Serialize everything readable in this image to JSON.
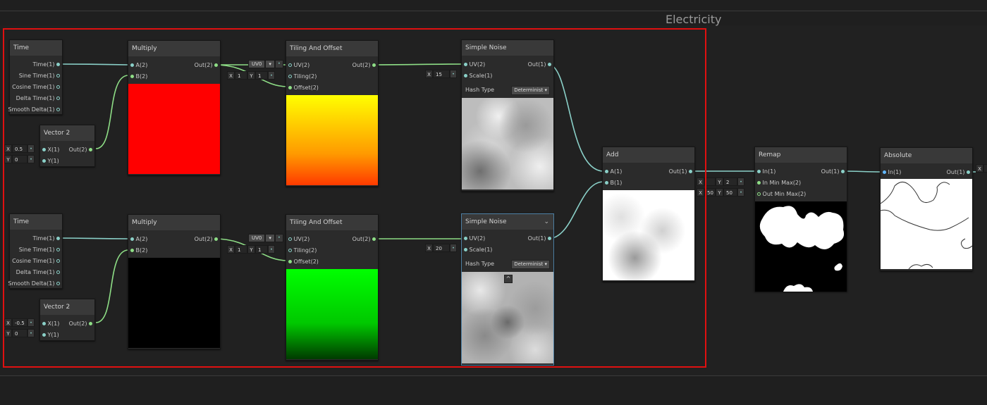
{
  "group": {
    "title": "Electricity"
  },
  "time_node": {
    "title": "Time",
    "outputs": [
      "Time(1)",
      "Sine Time(1)",
      "Cosine Time(1)",
      "Delta Time(1)",
      "Smooth Delta(1)"
    ]
  },
  "vector2_top": {
    "title": "Vector 2",
    "x_label": "X",
    "x_value": "0.5",
    "y_label": "Y",
    "y_value": "0",
    "in_x": "X(1)",
    "in_y": "Y(1)",
    "out": "Out(2)"
  },
  "vector2_bottom": {
    "title": "Vector 2",
    "x_label": "X",
    "x_value": "-0.5",
    "y_label": "Y",
    "y_value": "0",
    "in_x": "X(1)",
    "in_y": "Y(1)",
    "out": "Out(2)"
  },
  "multiply": {
    "title": "Multiply",
    "in_a": "A(2)",
    "in_b": "B(2)",
    "out": "Out(2)"
  },
  "tiling_top": {
    "title": "Tiling And Offset",
    "in_uv": "UV(2)",
    "in_tiling": "Tiling(2)",
    "in_offset": "Offset(2)",
    "out": "Out(2)",
    "uv_option": "UV0",
    "tx_label": "X",
    "tx_value": "1",
    "ty_label": "Y",
    "ty_value": "1"
  },
  "tiling_bottom": {
    "title": "Tiling And Offset",
    "in_uv": "UV(2)",
    "in_tiling": "Tiling(2)",
    "in_offset": "Offset(2)",
    "out": "Out(2)",
    "uv_option": "UV0",
    "tx_label": "X",
    "tx_value": "1",
    "ty_label": "Y",
    "ty_value": "1"
  },
  "noise_top": {
    "title": "Simple Noise",
    "in_uv": "UV(2)",
    "in_scale": "Scale(1)",
    "out": "Out(1)",
    "hash_label": "Hash Type",
    "hash_value": "Determinist",
    "scale_label": "X",
    "scale_value": "15"
  },
  "noise_bottom": {
    "title": "Simple Noise",
    "in_uv": "UV(2)",
    "in_scale": "Scale(1)",
    "out": "Out(1)",
    "hash_label": "Hash Type",
    "hash_value": "Determinist",
    "scale_label": "X",
    "scale_value": "20"
  },
  "add": {
    "title": "Add",
    "in_a": "A(1)",
    "in_b": "B(1)",
    "out": "Out(1)"
  },
  "remap": {
    "title": "Remap",
    "in": "In(1)",
    "in_min_max": "In Min Max(2)",
    "out_min_max": "Out Min Max(2)",
    "out": "Out(1)",
    "imm_x_label": "X",
    "imm_x": "",
    "imm_y_label": "Y",
    "imm_y": "2",
    "omm_x_label": "X",
    "omm_x": "50",
    "omm_y_label": "Y",
    "omm_y": "50"
  },
  "absolute": {
    "title": "Absolute",
    "in": "In(1)",
    "out": "Out(1)",
    "ext_label": "X"
  },
  "colors": {
    "red_preview": "#ff0000",
    "black_preview": "#000000",
    "highlight": "#e01010",
    "wire_green": "#8ede86",
    "wire_teal": "#8ad0c8"
  }
}
